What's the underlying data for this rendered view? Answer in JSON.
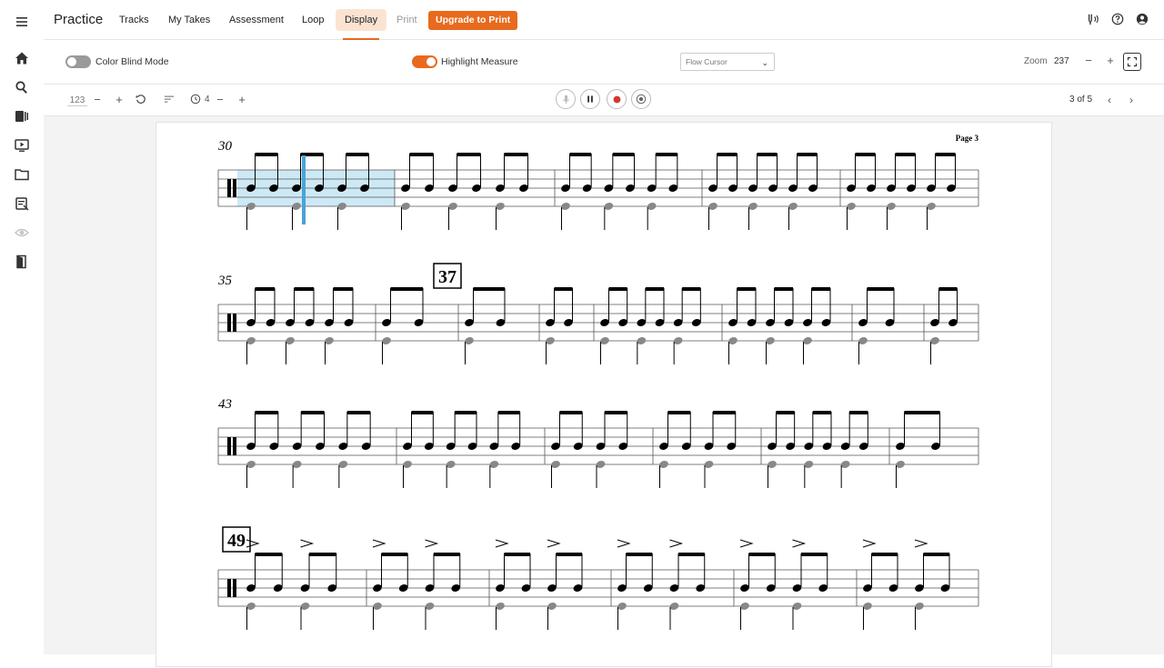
{
  "app": {
    "title": "Practice"
  },
  "nav": {
    "tabs": [
      {
        "label": "Tracks"
      },
      {
        "label": "My Takes"
      },
      {
        "label": "Assessment"
      },
      {
        "label": "Loop"
      },
      {
        "label": "Display"
      },
      {
        "label": "Print"
      }
    ],
    "upgrade_label": "Upgrade to Print"
  },
  "options": {
    "color_blind_label": "Color Blind Mode",
    "color_blind_on": false,
    "highlight_label": "Highlight Measure",
    "highlight_on": true,
    "cursor_select_value": "Flow Cursor",
    "zoom_label": "Zoom",
    "zoom_value": "237"
  },
  "toolbar": {
    "tempo_value": "123",
    "count_in_value": "4",
    "page_indicator": "3 of 5"
  },
  "score": {
    "page_label": "Page 3",
    "measure_numbers": [
      "30",
      "35",
      "43"
    ],
    "rehearsal_marks": [
      "37",
      "49"
    ]
  },
  "colors": {
    "accent": "#e86a1e",
    "active_tab_bg": "#fbe3d2",
    "highlight_measure": "#cde9f5",
    "cursor": "#4aa3d6",
    "record": "#d0392b"
  }
}
